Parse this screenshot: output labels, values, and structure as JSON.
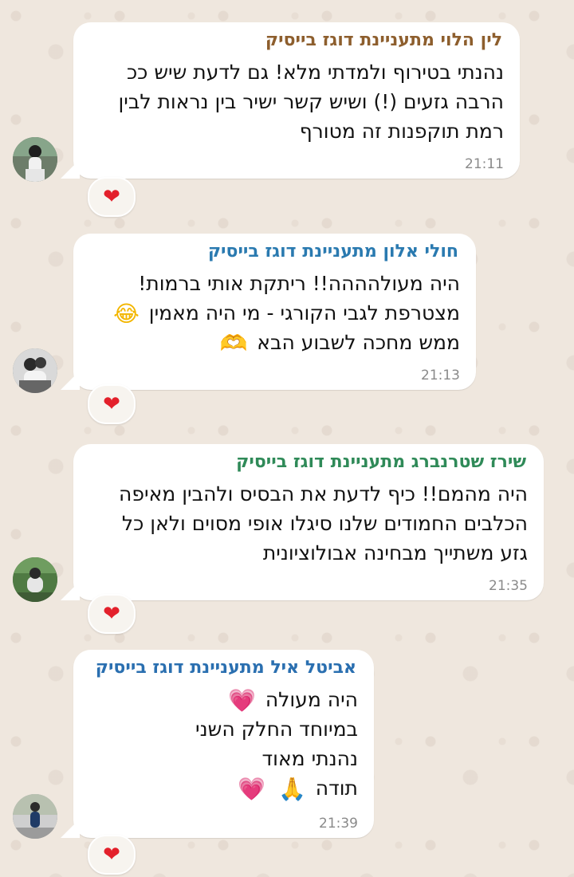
{
  "messages": [
    {
      "sender": "לין הלוי מתעניינת דוגז בייסיק",
      "sender_color": "#8d5e2d",
      "lines": [
        "נהנתי בטירוף ולמדתי מלא! גם לדעת שיש ככ",
        "הרבה גזעים (!) ושיש קשר ישיר בין נראות לבין",
        "רמת תוקפנות זה מטורף"
      ],
      "time": "21:11",
      "reaction": "❤"
    },
    {
      "sender": "חולי אלון מתעניינת דוגז בייסיק",
      "sender_color": "#2a7ab0",
      "lines": [
        "היה מעולהההה!! ריתקת אותי ברמות!",
        "מצטרפת לגבי הקורגי - מי היה מאמין",
        "ממש מחכה לשבוע הבא"
      ],
      "emoji": {
        "line2": "😂",
        "line3": "🫶"
      },
      "time": "21:13",
      "reaction": "❤"
    },
    {
      "sender": "שירז שטרנברג מתעניינת דוגז בייסיק",
      "sender_color": "#2f8a58",
      "lines": [
        "היה מהמם!! כיף לדעת את הבסיס ולהבין מאיפה",
        "הכלבים החמודים שלנו סיגלו אופי מסוים ולאן כל",
        "גזע משתייך מבחינה אבולוציונית"
      ],
      "time": "21:35",
      "reaction": "❤"
    },
    {
      "sender": "אביטל איל מתעניינת דוגז בייסיק",
      "sender_color": "#2a6fb0",
      "lines": [
        "היה מעולה",
        "במיוחד החלק השני",
        "נהנתי מאוד",
        "תודה"
      ],
      "emoji": {
        "line1": "💗",
        "line4a": "🙏",
        "line4b": "💗"
      },
      "time": "21:39",
      "reaction": "❤"
    }
  ]
}
